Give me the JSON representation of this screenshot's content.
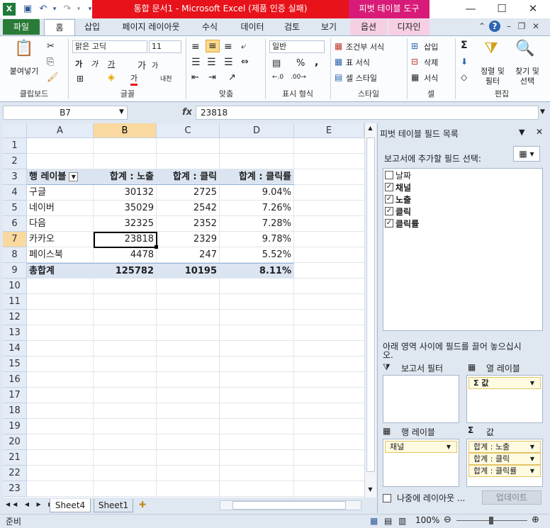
{
  "title": {
    "text": "통합 문서1  -  Microsoft Excel (제품 인증 실패)",
    "pivot_tools": "피벗 테이블 도구"
  },
  "tabs": {
    "file": "파일",
    "items": [
      "홈",
      "삽입",
      "페이지 레이아웃",
      "수식",
      "데이터",
      "검토",
      "보기"
    ],
    "pivot_items": [
      "옵션",
      "디자인"
    ]
  },
  "ribbon": {
    "clipboard": {
      "paste": "붙여넣기",
      "label": "클립보드"
    },
    "font": {
      "name": "맑은 고딕",
      "size": "11",
      "bold": "가",
      "italic": "가",
      "underline": "가",
      "grow": "가",
      "shrink": "가",
      "phonetic": "내천",
      "fontcolor": "가",
      "label": "글꼴"
    },
    "align": {
      "label": "맞춤"
    },
    "number": {
      "format": "일반",
      "percent": "%",
      "comma": ",",
      "label": "표시 형식"
    },
    "style": {
      "cond": "조건부 서식",
      "table": "표 서식",
      "cell": "셀 스타일",
      "label": "스타일"
    },
    "cells": {
      "insert": "삽입",
      "delete": "삭제",
      "format": "서식",
      "label": "셀"
    },
    "editing": {
      "sum": "Σ",
      "sort": "정렬 및\n필터",
      "sort_1": "정렬 및",
      "sort_2": "필터",
      "find_1": "찾기 및",
      "find_2": "선택",
      "label": "편집"
    }
  },
  "formula_bar": {
    "name_box": "B7",
    "fx": "fx",
    "value": "23818"
  },
  "columns": [
    "A",
    "B",
    "C",
    "D",
    "E"
  ],
  "rows": [
    "1",
    "2",
    "3",
    "4",
    "5",
    "6",
    "7",
    "8",
    "9",
    "10",
    "11",
    "12",
    "13",
    "14",
    "15",
    "16",
    "17",
    "18",
    "19",
    "20",
    "21",
    "22",
    "23"
  ],
  "pivot": {
    "headers": [
      "행 레이블",
      "합계 : 노출",
      "합계 : 클릭",
      "합계 : 클릭률"
    ],
    "rows": [
      {
        "label": "구글",
        "exposure": "30132",
        "clicks": "2725",
        "ctr": "9.04%"
      },
      {
        "label": "네이버",
        "exposure": "35029",
        "clicks": "2542",
        "ctr": "7.26%"
      },
      {
        "label": "다음",
        "exposure": "32325",
        "clicks": "2352",
        "ctr": "7.28%"
      },
      {
        "label": "카카오",
        "exposure": "23818",
        "clicks": "2329",
        "ctr": "9.78%"
      },
      {
        "label": "페이스북",
        "exposure": "4478",
        "clicks": "247",
        "ctr": "5.52%"
      }
    ],
    "total": {
      "label": "총합계",
      "exposure": "125782",
      "clicks": "10195",
      "ctr": "8.11%"
    }
  },
  "sheet_tabs": [
    "Sheet4",
    "Sheet1"
  ],
  "status": {
    "ready": "준비",
    "zoom": "100%"
  },
  "field_list": {
    "title": "피벗 테이블 필드 목록",
    "choose_label": "보고서에 추가할 필드 선택:",
    "fields": [
      {
        "name": "날짜",
        "checked": false
      },
      {
        "name": "채널",
        "checked": true
      },
      {
        "name": "노출",
        "checked": true
      },
      {
        "name": "클릭",
        "checked": true
      },
      {
        "name": "클릭률",
        "checked": true
      }
    ],
    "drag_label": "아래 영역 사이에 필드를 끌어 놓으십시오.",
    "report_filter": "보고서 필터",
    "column_labels": "열 레이블",
    "row_labels": "행 레이블",
    "values": "값",
    "column_items": [
      "Σ 값"
    ],
    "row_items": [
      "채널"
    ],
    "value_items": [
      "합계 : 노출",
      "합계 : 클릭",
      "합계 : 클릭률"
    ],
    "defer_label": "나중에 레이아웃 ...",
    "update_button": "업데이트"
  },
  "colors": {
    "excel_green": "#2a7b37",
    "title_red": "#e8121a",
    "pivot_pink": "#d81b78",
    "selection": "#f9d99f",
    "pivot_header": "#dbe5f1"
  }
}
